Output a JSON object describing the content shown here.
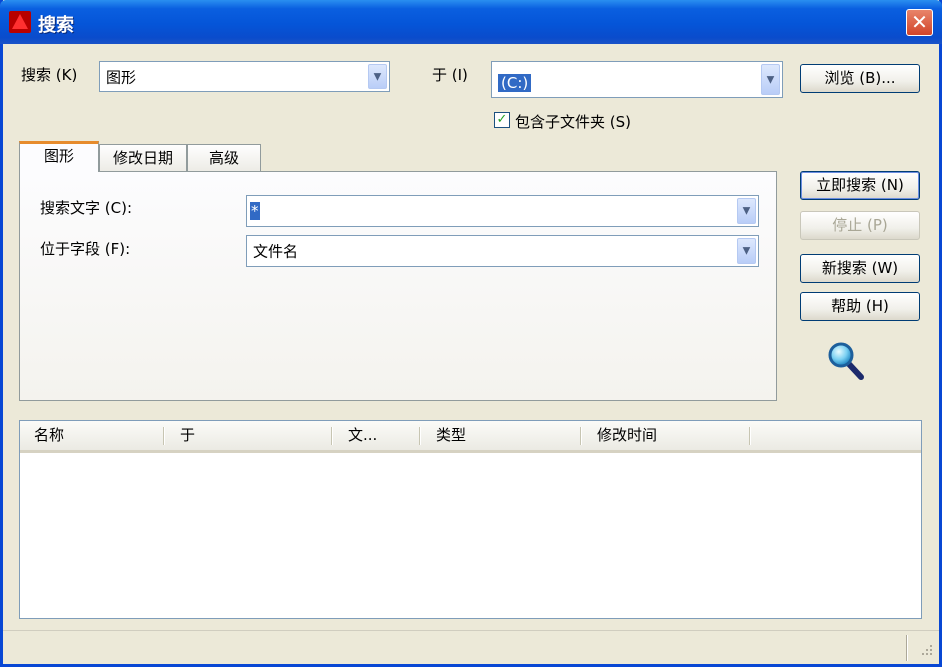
{
  "window": {
    "title": "搜索",
    "close_glyph": "✕"
  },
  "search_row": {
    "label": "搜索 (K)",
    "type_value": "图形",
    "location_label": "于 (I)",
    "location_value": "(C:)",
    "browse_button": "浏览 (B)...",
    "include_subfolders": {
      "label": "包含子文件夹 (S)",
      "checked": true
    }
  },
  "tabs": [
    {
      "label": "图形",
      "active": true
    },
    {
      "label": "修改日期",
      "active": false
    },
    {
      "label": "高级",
      "active": false
    }
  ],
  "tab_panel": {
    "search_text_label": "搜索文字 (C):",
    "search_text_value": "*",
    "field_label": "位于字段 (F):",
    "field_value": "文件名"
  },
  "buttons": {
    "search_now": "立即搜索 (N)",
    "stop": "停止 (P)",
    "new_search": "新搜索 (W)",
    "help": "帮助 (H)"
  },
  "results": {
    "columns": [
      "名称",
      "于",
      "文...",
      "类型",
      "修改时间"
    ],
    "rows": []
  },
  "icons": {
    "app": "autocad-icon",
    "magnifier": "magnifier-icon",
    "dropdown": "chevron-down-icon",
    "grip": "resize-grip-icon"
  },
  "colors": {
    "titlebar": "#0a5fe0",
    "selection": "#316ac5",
    "tab_accent": "#e68b2c",
    "close": "#d2442a"
  }
}
